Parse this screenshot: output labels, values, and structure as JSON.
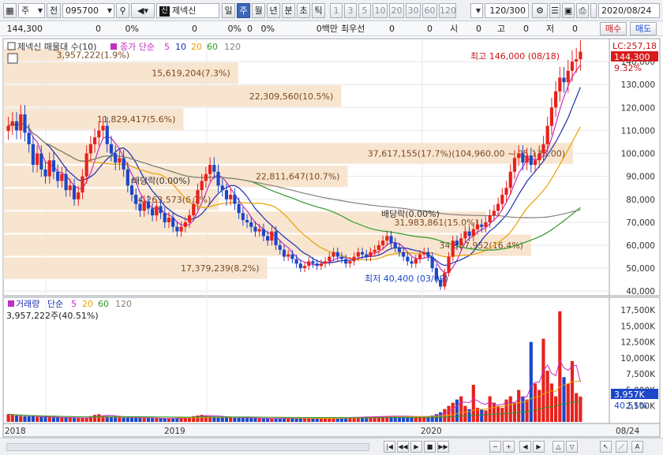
{
  "toolbar": {
    "period_type": "주",
    "prev_label": "전",
    "stock_code": "095700",
    "market_badge": "신",
    "stock_name": "제넥신",
    "periods": [
      "일",
      "주",
      "월",
      "년",
      "분",
      "초",
      "틱"
    ],
    "selected_period": "주",
    "intervals": [
      "1",
      "3",
      "5",
      "10",
      "20",
      "30",
      "60",
      "120"
    ],
    "count": "120/300",
    "date": "2020/08/24"
  },
  "quote": {
    "price": "144,300",
    "change": "0",
    "change_pct": "0%",
    "volume": "0",
    "volume_pct": "0%",
    "amount": "0",
    "amount_pct": "0%",
    "amount_unit": "0백만",
    "best_bid_label": "최우선",
    "best_bid_1": "0",
    "best_bid_2": "0",
    "open_label": "시",
    "open": "0",
    "high_label": "고",
    "high": "0",
    "low_label": "저",
    "low": "0",
    "buy_label": "매수",
    "sell_label": "매도"
  },
  "colors": {
    "up": "#e8211c",
    "down": "#1c47c8",
    "ma5": "#c22fc2",
    "ma10": "#1c2fb0",
    "ma20": "#e9a000",
    "ma60": "#2c9a2c",
    "ma120": "#8a7f7a",
    "profile": "#f7e1c8",
    "profile_text": "#7a4a20"
  },
  "price_panel": {
    "legend_name": "제넥신 매물대 수(10)",
    "legend_ma_label": "종가 단순",
    "ma_periods": [
      "5",
      "10",
      "20",
      "60",
      "120"
    ],
    "lc_label": "LC:257,18",
    "current_price_tag": "144,300",
    "current_pct_tag": "9.32%",
    "high_annotation": "최고 146,000 (08/18)",
    "low_annotation": "최저 40,400 (03/09)",
    "dividend_labels": [
      "배당락(0.00%)",
      "배당락(0.00%)"
    ],
    "y_ticks": [
      "140,000",
      "130,000",
      "120,000",
      "110,000",
      "100,000",
      "90,000",
      "80,000",
      "70,000",
      "60,000",
      "50,000",
      "40,000"
    ]
  },
  "volume_profile": [
    {
      "label": "3,957,222(1.9%)",
      "price_low": 140000,
      "price_high": 146000,
      "pct": 1.9
    },
    {
      "label": "15,619,204(7.3%)",
      "price_low": 130000,
      "price_high": 140000,
      "pct": 7.3
    },
    {
      "label": "22,309,560(10.5%)",
      "price_low": 120000,
      "price_high": 130000,
      "pct": 10.5
    },
    {
      "label": "11,829,417(5.6%)",
      "price_low": 110000,
      "price_high": 120000,
      "pct": 5.6
    },
    {
      "label": "37,617,155(17.7%)(104,960.00 ~ 95,135.00)",
      "price_low": 95135,
      "price_high": 104960,
      "pct": 17.7
    },
    {
      "label": "22,811,647(10.7%)",
      "price_low": 85000,
      "price_high": 95000,
      "pct": 10.7
    },
    {
      "label": "14,263,573(6.7%)",
      "price_low": 75000,
      "price_high": 85000,
      "pct": 6.7
    },
    {
      "label": "31,983,861(15.0%)",
      "price_low": 65000,
      "price_high": 75000,
      "pct": 15.0
    },
    {
      "label": "34,887,952(16.4%)",
      "price_low": 55000,
      "price_high": 65000,
      "pct": 16.4
    },
    {
      "label": "17,379,239(8.2%)",
      "price_low": 45000,
      "price_high": 55000,
      "pct": 8.2
    }
  ],
  "volume_panel": {
    "legend_name": "거래량",
    "legend_ma_label": "단순",
    "ma_periods": [
      "5",
      "20",
      "60",
      "120"
    ],
    "summary": "3,957,222주(40.51%)",
    "current_tag": "3,957K",
    "current_pct_tag": "40.51%",
    "y_ticks": [
      "17,500K",
      "15,000K",
      "12,500K",
      "10,000K",
      "7,500K",
      "5,000K",
      "2,500K"
    ]
  },
  "x_axis": {
    "labels": [
      "2018",
      "2019",
      "2020"
    ],
    "last_label": "08/24"
  },
  "chart_data": {
    "type": "candlestick",
    "y_range": [
      38000,
      150000
    ],
    "volume_range": [
      0,
      18500
    ],
    "volume_unit": "K",
    "weeks": 140,
    "closes": [
      112000,
      114000,
      110000,
      117000,
      109000,
      104000,
      95000,
      100000,
      93000,
      90000,
      97000,
      92000,
      88000,
      91000,
      84000,
      86000,
      80000,
      83000,
      90000,
      100000,
      104000,
      107000,
      110000,
      112000,
      104000,
      100000,
      96000,
      98000,
      93000,
      86000,
      82000,
      78000,
      75000,
      79000,
      76000,
      73000,
      77000,
      74000,
      70000,
      72000,
      68000,
      66000,
      68000,
      70000,
      73000,
      78000,
      84000,
      88000,
      91000,
      95000,
      92000,
      86000,
      84000,
      80000,
      82000,
      78000,
      74000,
      71000,
      70000,
      68000,
      66000,
      67000,
      64000,
      62000,
      66000,
      60000,
      58000,
      55000,
      56000,
      54000,
      52000,
      50000,
      51000,
      53000,
      52000,
      51000,
      52000,
      53000,
      55000,
      57000,
      55000,
      54000,
      52000,
      53000,
      55000,
      57000,
      56000,
      55000,
      57000,
      58000,
      60000,
      62000,
      64000,
      61000,
      59000,
      57000,
      55000,
      53000,
      52000,
      54000,
      56000,
      57000,
      55000,
      50000,
      45000,
      42000,
      48000,
      55000,
      62000,
      60000,
      63000,
      66000,
      64000,
      67000,
      69000,
      68000,
      70000,
      73000,
      75000,
      78000,
      82000,
      85000,
      92000,
      98000,
      100000,
      96000,
      99000,
      95000,
      97000,
      100000,
      104000,
      112000,
      120000,
      127000,
      133000,
      131000,
      136000,
      140000,
      141000,
      144300
    ],
    "volumes": [
      1200,
      1100,
      1000,
      950,
      900,
      880,
      860,
      800,
      780,
      760,
      740,
      700,
      680,
      660,
      640,
      620,
      600,
      600,
      580,
      620,
      900,
      1100,
      1200,
      1000,
      900,
      850,
      800,
      760,
      700,
      680,
      660,
      640,
      620,
      600,
      580,
      560,
      540,
      520,
      500,
      520,
      540,
      600,
      650,
      700,
      760,
      900,
      1000,
      1100,
      1000,
      900,
      850,
      800,
      760,
      700,
      680,
      660,
      640,
      620,
      600,
      580,
      560,
      540,
      520,
      500,
      520,
      540,
      560,
      580,
      600,
      560,
      540,
      520,
      500,
      520,
      540,
      560,
      580,
      600,
      620,
      640,
      660,
      680,
      700,
      720,
      740,
      760,
      780,
      800,
      820,
      840,
      860,
      880,
      900,
      920,
      900,
      880,
      860,
      840,
      820,
      800,
      800,
      850,
      900,
      1000,
      1200,
      1500,
      2000,
      2500,
      3000,
      3500,
      4000,
      2500,
      2000,
      5800,
      2200,
      2000,
      1800,
      4000,
      3000,
      2500,
      2200,
      3500,
      4000,
      3000,
      5000,
      4000,
      3500,
      12500,
      6000,
      5000,
      13000,
      8000,
      6000,
      4000,
      17300,
      7000,
      6000,
      9500,
      4500,
      3957
    ],
    "x_labels": [
      "2018",
      "2019",
      "2020",
      "08/24"
    ]
  }
}
